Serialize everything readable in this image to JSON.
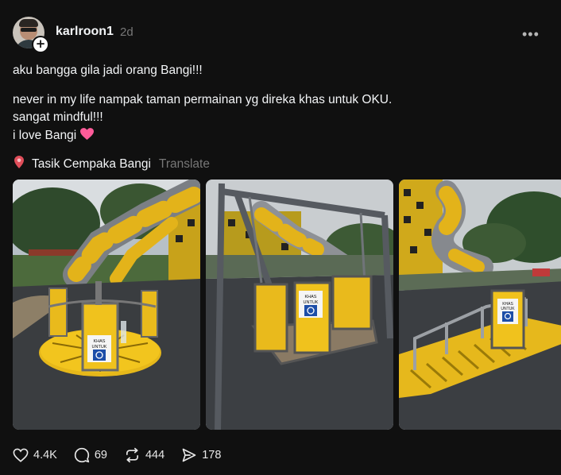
{
  "post": {
    "username": "karlroon1",
    "time": "2d",
    "lines": [
      "aku bangga gila jadi orang Bangi!!!",
      "never in my life nampak taman permainan yg direka khas untuk OKU.",
      "sangat mindful!!!",
      "i love Bangi"
    ],
    "location": "Tasik Cempaka Bangi",
    "translate_label": "Translate",
    "sign_text": [
      "KHAS",
      "UNTUK"
    ],
    "stats": {
      "likes": "4.4K",
      "replies": "69",
      "reposts": "444",
      "shares": "178"
    }
  }
}
